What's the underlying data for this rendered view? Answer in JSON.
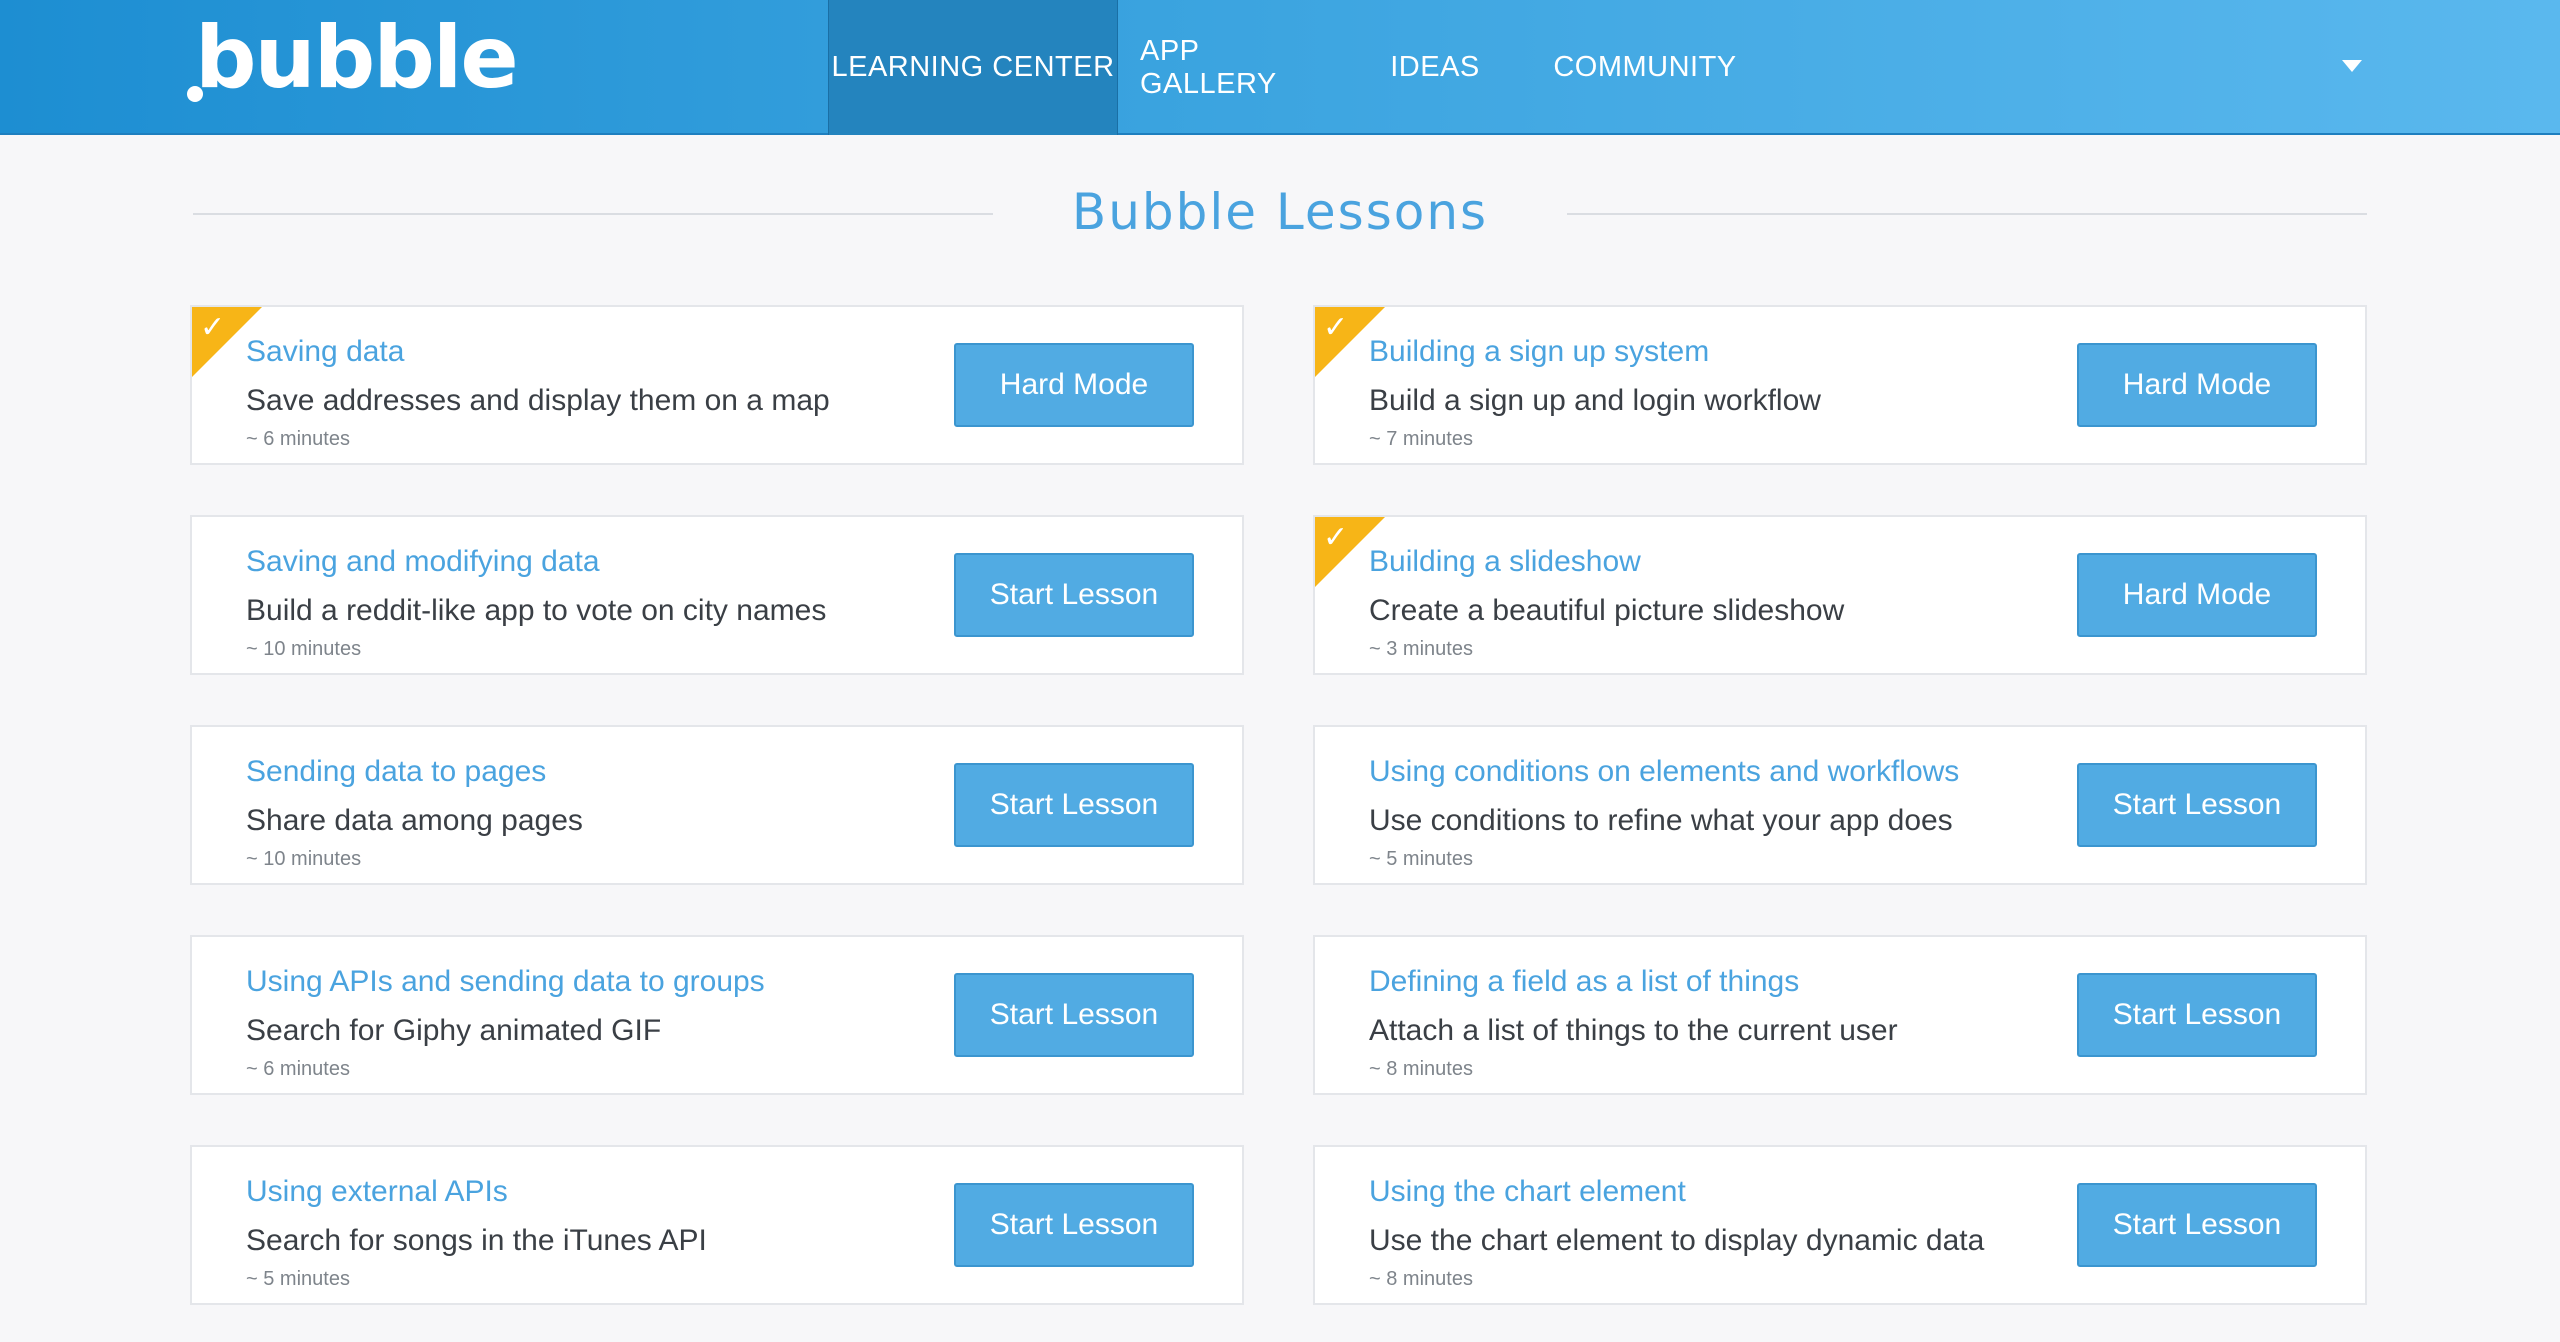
{
  "header": {
    "logo_text": "bubble",
    "nav": [
      {
        "label": "LEARNING CENTER",
        "active": true
      },
      {
        "label": "APP GALLERY",
        "active": false
      },
      {
        "label": "IDEAS",
        "active": false
      },
      {
        "label": "COMMUNITY",
        "active": false
      }
    ],
    "menu_icon": "chevron-down-icon"
  },
  "section": {
    "title": "Bubble Lessons"
  },
  "lessons": [
    {
      "title": "Saving data",
      "description": "Save addresses and display them on a map",
      "duration": "~ 6 minutes",
      "button": "Hard Mode",
      "completed": true
    },
    {
      "title": "Building a sign up system",
      "description": "Build a sign up and login workflow",
      "duration": "~ 7 minutes",
      "button": "Hard Mode",
      "completed": true
    },
    {
      "title": "Saving and modifying data",
      "description": "Build a reddit-like app to vote on city names",
      "duration": "~ 10 minutes",
      "button": "Start Lesson",
      "completed": false
    },
    {
      "title": "Building a slideshow",
      "description": "Create a beautiful picture slideshow",
      "duration": "~ 3 minutes",
      "button": "Hard Mode",
      "completed": true
    },
    {
      "title": "Sending data to pages",
      "description": "Share data among pages",
      "duration": "~ 10 minutes",
      "button": "Start Lesson",
      "completed": false
    },
    {
      "title": "Using conditions on elements and workflows",
      "description": "Use conditions to refine what your app does",
      "duration": "~ 5 minutes",
      "button": "Start Lesson",
      "completed": false
    },
    {
      "title": "Using APIs and sending data to groups",
      "description": "Search for Giphy animated GIF",
      "duration": "~ 6 minutes",
      "button": "Start Lesson",
      "completed": false
    },
    {
      "title": "Defining a field as a list of things",
      "description": "Attach a list of things to the current user",
      "duration": "~ 8 minutes",
      "button": "Start Lesson",
      "completed": false
    },
    {
      "title": "Using external APIs",
      "description": "Search for songs in the iTunes API",
      "duration": "~ 5 minutes",
      "button": "Start Lesson",
      "completed": false
    },
    {
      "title": "Using the chart element",
      "description": "Use the chart element to display dynamic data",
      "duration": "~ 8 minutes",
      "button": "Start Lesson",
      "completed": false
    }
  ],
  "colors": {
    "header_start": "#1d8ed2",
    "header_end": "#5ab8ee",
    "accent": "#4aa3df",
    "button": "#51abe3",
    "completed_badge": "#f7b517",
    "page_bg": "#f7f7f9"
  }
}
